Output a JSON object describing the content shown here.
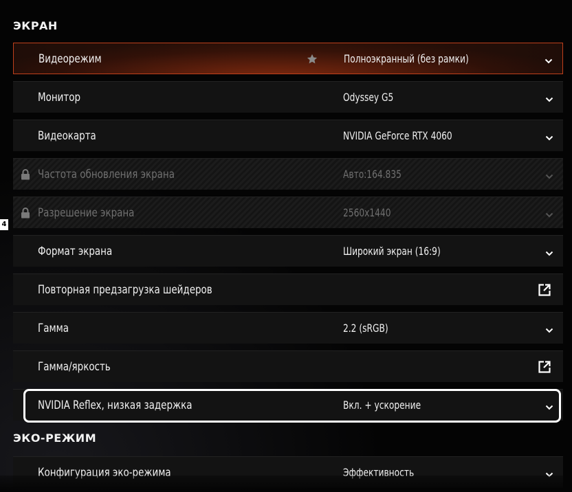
{
  "sections": [
    {
      "title": "ЭКРАН"
    },
    {
      "title": "ЭКО-РЕЖИМ"
    }
  ],
  "rows": [
    {
      "label": "Видеорежим",
      "value": "Полноэкранный (без рамки)",
      "control": "dropdown",
      "state": "active",
      "favorite": true
    },
    {
      "label": "Монитор",
      "value": "Odyssey G5",
      "control": "dropdown",
      "state": "normal"
    },
    {
      "label": "Видеокарта",
      "value": "NVIDIA GeForce RTX 4060",
      "control": "dropdown",
      "state": "normal"
    },
    {
      "label": "Частота обновления экрана",
      "value": "Авто:164.835",
      "control": "dropdown",
      "state": "locked"
    },
    {
      "label": "Разрешение экрана",
      "value": "2560x1440",
      "control": "dropdown",
      "state": "locked"
    },
    {
      "label": "Формат экрана",
      "value": "Широкий экран (16:9)",
      "control": "dropdown",
      "state": "normal"
    },
    {
      "label": "Повторная предзагрузка шейдеров",
      "value": "",
      "control": "external",
      "state": "normal"
    },
    {
      "label": "Гамма",
      "value": "2.2 (sRGB)",
      "control": "dropdown",
      "state": "normal"
    },
    {
      "label": "Гамма/яркость",
      "value": "",
      "control": "external",
      "state": "normal"
    },
    {
      "label": "NVIDIA Reflex, низкая задержка",
      "value": "Вкл. + ускорение",
      "control": "dropdown",
      "state": "focused"
    },
    {
      "label": "Конфигурация эко-режима",
      "value": "Эффективность",
      "control": "dropdown",
      "state": "normal"
    }
  ],
  "side_badge": "4",
  "colors": {
    "accent": "#c0401c",
    "row_bg": "#131313",
    "locked_text": "#6f6f6f",
    "focus_ring": "#ffffff"
  },
  "icons": {
    "dropdown": "chevron-down-icon",
    "external": "external-link-icon",
    "locked": "lock-icon",
    "favorite": "star-icon"
  }
}
